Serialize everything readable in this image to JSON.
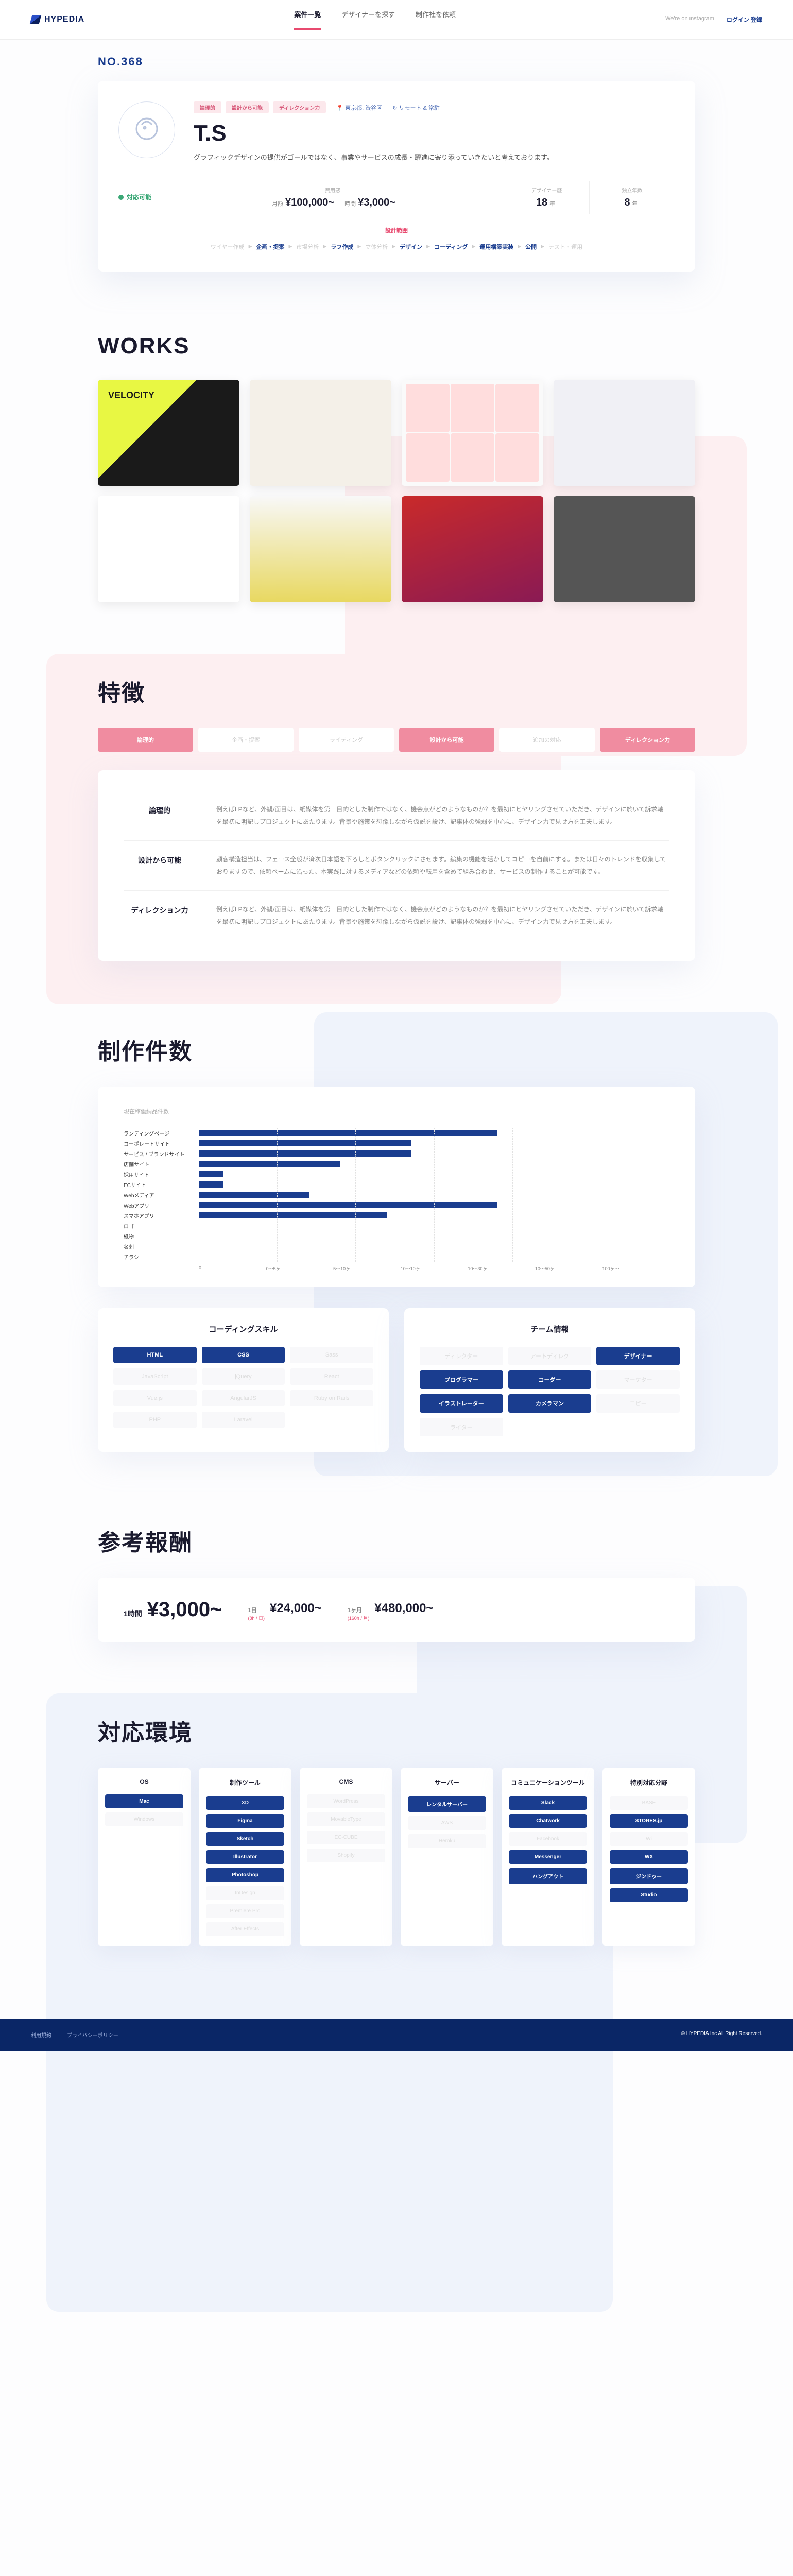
{
  "header": {
    "logo": "HYPEDIA",
    "nav": [
      "案件一覧",
      "デザイナーを探す",
      "制作社を依頼"
    ],
    "nav_active": 0,
    "contact": "We're on instagram",
    "login": "ログイン 登録"
  },
  "profile": {
    "no_label": "NO.368",
    "tags": [
      "論理的",
      "設計から可能",
      "ディレクション力"
    ],
    "location": "東京都, 渋谷区",
    "remote": "リモート & 常駐",
    "name": "T.S",
    "desc": "グラフィックデザインの提供がゴールではなく、事業やサービスの成長・躍進に寄り添っていきたいと考えております。",
    "status": "対応可能",
    "stats": [
      {
        "label": "費用感",
        "prefix": "月額",
        "val": "¥100,000~",
        "prefix2": "時間",
        "val2": "¥3,000~"
      },
      {
        "label": "デザイナー歴",
        "val": "18",
        "unit": "年"
      },
      {
        "label": "独立年数",
        "val": "8",
        "unit": "年"
      }
    ],
    "process_label": "設計範囲",
    "steps": [
      "ワイヤー作成",
      "企画・提案",
      "市場分析",
      "ラフ作成",
      "立体分析",
      "デザイン",
      "コーディング",
      "運用構築実装",
      "公開",
      "テスト・運用"
    ],
    "steps_on": [
      1,
      3,
      5,
      6,
      7,
      8
    ]
  },
  "works": {
    "title": "WORKS"
  },
  "features": {
    "title": "特徴",
    "tabs": [
      "論理的",
      "企画・提案",
      "ライティング",
      "設計から可能",
      "追加の対応",
      "ディレクション力"
    ],
    "tabs_active": [
      0,
      3,
      5
    ],
    "rows": [
      {
        "name": "論理的",
        "text": "例えばLPなど、外観/面目は、紙媒体を第一目的とした制作ではなく、機会点がどのようなものか？を最初にヒヤリングさせていただき、デザインに於いて訴求軸を最初に明記しプロジェクトにあたります。背景や施策を想像しながら仮説を設け、記事体の強弱を中心に、デザイン力で見せ方を工夫します。"
      },
      {
        "name": "設計から可能",
        "text": "顧客構造担当は、フェース全般が済次日本語を下ろしとボタンクリックにさせます。編集の機能を活かしてコピーを自前にする。または日々のトレンドを収集しておりますので、依頼ベームに沿った、本実践に対するメディアなどの依頼や転用を含めて組み合わせ、サービスの制作することが可能です。"
      },
      {
        "name": "ディレクション力",
        "text": "例えばLPなど、外観/面目は、紙媒体を第一目的とした制作ではなく、機会点がどのようなものか？を最初にヒヤリングさせていただき、デザインに於いて訴求軸を最初に明記しプロジェクトにあたります。背景や施策を想像しながら仮説を設け、記事体の強弱を中心に、デザイン力で見せ方を工夫します。"
      }
    ]
  },
  "chart_data": {
    "type": "bar",
    "title": "制作件数",
    "subtitle": "現在稼働納品件数",
    "categories": [
      "ランディングページ",
      "コーポレートサイト",
      "サービス / ブランドサイト",
      "店舗サイト",
      "採用サイト",
      "ECサイト",
      "Webメディア",
      "Webアプリ",
      "スマホアプリ",
      "ロゴ",
      "紙物",
      "名刺",
      "チラシ"
    ],
    "values": [
      38,
      27,
      27,
      18,
      3,
      3,
      14,
      38,
      24,
      0,
      0,
      0,
      0
    ],
    "xticks": [
      "0",
      "0～5ヶ",
      "5～10ヶ",
      "10～10ヶ",
      "10～30ヶ",
      "10～50ヶ",
      "100ヶ～"
    ],
    "xmax": 60
  },
  "skills": {
    "coding": {
      "title": "コーディングスキル",
      "items": [
        {
          "l": "HTML",
          "on": true
        },
        {
          "l": "CSS",
          "on": true
        },
        {
          "l": "Sass",
          "on": false
        },
        {
          "l": "JavaScript",
          "on": false
        },
        {
          "l": "jQuery",
          "on": false
        },
        {
          "l": "React",
          "on": false
        },
        {
          "l": "Vue.js",
          "on": false
        },
        {
          "l": "AngularJS",
          "on": false
        },
        {
          "l": "Ruby on Rails",
          "on": false
        },
        {
          "l": "PHP",
          "on": false
        },
        {
          "l": "Laravel",
          "on": false
        }
      ]
    },
    "team": {
      "title": "チーム情報",
      "items": [
        {
          "l": "ディレクター",
          "on": false
        },
        {
          "l": "アートディレク",
          "on": false
        },
        {
          "l": "デザイナー",
          "on": true
        },
        {
          "l": "プログラマー",
          "on": true
        },
        {
          "l": "コーダー",
          "on": true
        },
        {
          "l": "マーケター",
          "on": false
        },
        {
          "l": "イラストレーター",
          "on": true
        },
        {
          "l": "カメラマン",
          "on": true
        },
        {
          "l": "コピー",
          "on": false
        },
        {
          "l": "ライター",
          "on": false
        }
      ]
    }
  },
  "price": {
    "title": "参考報酬",
    "items": [
      {
        "label": "1時間",
        "sub": "",
        "val": "¥3,000~"
      },
      {
        "label": "1日",
        "sub": "(8h / 日)",
        "val": "¥24,000~"
      },
      {
        "label": "1ヶ月",
        "sub": "(160h / 月)",
        "val": "¥480,000~"
      }
    ]
  },
  "env": {
    "title": "対応環境",
    "cols": [
      {
        "title": "OS",
        "items": [
          {
            "l": "Mac",
            "on": true
          },
          {
            "l": "Windows",
            "on": false
          }
        ]
      },
      {
        "title": "制作ツール",
        "items": [
          {
            "l": "XD",
            "on": true
          },
          {
            "l": "Figma",
            "on": true
          },
          {
            "l": "Sketch",
            "on": true
          },
          {
            "l": "Illustrator",
            "on": true
          },
          {
            "l": "Photoshop",
            "on": true
          },
          {
            "l": "InDesign",
            "on": false
          },
          {
            "l": "Premiere Pro",
            "on": false
          },
          {
            "l": "After Effects",
            "on": false
          }
        ]
      },
      {
        "title": "CMS",
        "items": [
          {
            "l": "WordPress",
            "on": false
          },
          {
            "l": "MovableType",
            "on": false
          },
          {
            "l": "EC-CUBE",
            "on": false
          },
          {
            "l": "Shopify",
            "on": false
          }
        ]
      },
      {
        "title": "サーバー",
        "items": [
          {
            "l": "レンタルサーバー",
            "on": true
          },
          {
            "l": "AWS",
            "on": false
          },
          {
            "l": "Heroku",
            "on": false
          }
        ]
      },
      {
        "title": "コミュニケーションツール",
        "items": [
          {
            "l": "Slack",
            "on": true
          },
          {
            "l": "Chatwork",
            "on": true
          },
          {
            "l": "Facebook",
            "on": false
          },
          {
            "l": "Messenger",
            "on": true
          },
          {
            "l": "ハングアウト",
            "on": true
          }
        ]
      },
      {
        "title": "特別対応分野",
        "items": [
          {
            "l": "BASE",
            "on": false
          },
          {
            "l": "STORES.jp",
            "on": true
          },
          {
            "l": "Wi",
            "on": false
          },
          {
            "l": "WX",
            "on": true
          },
          {
            "l": "ジンドゥー",
            "on": true
          },
          {
            "l": "Studio",
            "on": true
          }
        ]
      }
    ]
  },
  "footer": {
    "links": [
      "利用規約",
      "プライバシーポリシー"
    ],
    "copy": "© HYPEDIA Inc All Right Reserved."
  }
}
